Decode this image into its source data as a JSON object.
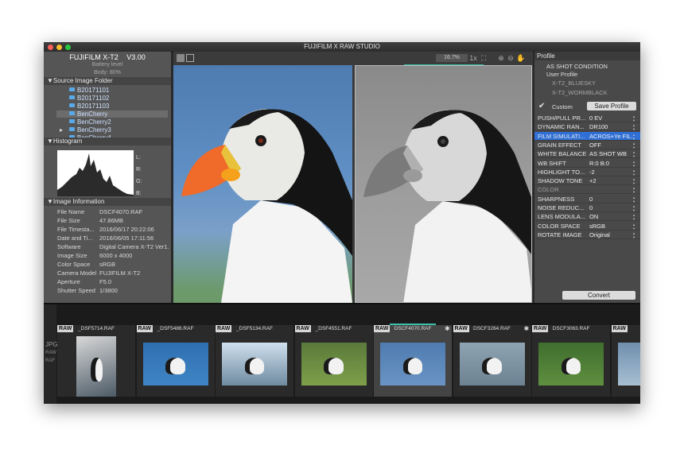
{
  "app": {
    "title": "FUJIFILM X RAW STUDIO"
  },
  "camera": {
    "model": "FUJIFILM X-T2",
    "version": "V3.00",
    "battery_label": "Battery level",
    "body_level": "Body: 80%"
  },
  "source_folder": {
    "header": "▼Source Image Folder",
    "folders": [
      "B20171101",
      "B20171102",
      "B20171103",
      "BenCherry",
      "BenCherry2",
      "BenCherry3",
      "BenCherry4"
    ],
    "selected_index": 3
  },
  "histogram": {
    "header": "▼Histogram",
    "labels": [
      "L:",
      "R:",
      "G:",
      "B:"
    ]
  },
  "image_info": {
    "header": "▼Image Information",
    "rows": [
      {
        "k": "File Name",
        "v": "DSCF4070.RAF"
      },
      {
        "k": "File Size",
        "v": "47.86MB"
      },
      {
        "k": "File Timesta...",
        "v": "2016/06/17 20:22:06"
      },
      {
        "k": "Date and Ti...",
        "v": "2016/06/05 17:11:56"
      },
      {
        "k": "Software",
        "v": "Digital Camera X-T2 Ver1."
      },
      {
        "k": "Image Size",
        "v": "6000 x 4000"
      },
      {
        "k": "Color Space",
        "v": "sRGB"
      },
      {
        "k": "Camera Model",
        "v": "FUJIFILM X-T2"
      },
      {
        "k": "Aperture",
        "v": "F5.0"
      },
      {
        "k": "Shutter Speed",
        "v": "1/3800"
      }
    ]
  },
  "viewer": {
    "zoom": "16.7%"
  },
  "profile": {
    "header": "Profile",
    "as_shot": "AS SHOT CONDITION",
    "user_profile": "User Profile",
    "presets": [
      "X-T2_BLUESKY",
      "X-T2_WORMBLACK"
    ],
    "custom_label": "Custom",
    "save_label": "Save Profile",
    "params": [
      {
        "k": "PUSH/PULL PR...",
        "v": "0 EV"
      },
      {
        "k": "DYNAMIC RAN...",
        "v": "DR100"
      },
      {
        "k": "FILM SIMULATI...",
        "v": "ACROS+Ye FIL..."
      },
      {
        "k": "GRAIN EFFECT",
        "v": "OFF"
      },
      {
        "k": "WHITE BALANCE",
        "v": "AS SHOT WB"
      },
      {
        "k": "WB SHIFT",
        "v": "R:0 B:0"
      },
      {
        "k": "HIGHLIGHT TO...",
        "v": "-2"
      },
      {
        "k": "SHADOW TONE",
        "v": "+2"
      },
      {
        "k": "COLOR",
        "v": ""
      },
      {
        "k": "SHARPNESS",
        "v": "0"
      },
      {
        "k": "NOISE REDUC...",
        "v": "0"
      },
      {
        "k": "LENS MODULA...",
        "v": "ON"
      },
      {
        "k": "COLOR SPACE",
        "v": "sRGB"
      },
      {
        "k": "ROTATE IMAGE",
        "v": "Original"
      }
    ],
    "convert_label": "Convert"
  },
  "filmstrip": {
    "raw_badge": "RAW",
    "rail_labels": [
      "JPG",
      "RAW",
      "RAF"
    ],
    "items": [
      {
        "name": "_DSF5714.RAF",
        "selected": false,
        "star": false
      },
      {
        "name": "_DSF5486.RAF",
        "selected": false,
        "star": false
      },
      {
        "name": "_DSF5134.RAF",
        "selected": false,
        "star": false
      },
      {
        "name": "_DSF4551.RAF",
        "selected": false,
        "star": false
      },
      {
        "name": "DSCF4070.RAF",
        "selected": true,
        "star": true
      },
      {
        "name": "DSCF3264.RAF",
        "selected": false,
        "star": true
      },
      {
        "name": "DSCF3063.RAF",
        "selected": false,
        "star": false
      },
      {
        "name": "",
        "selected": false,
        "star": false
      }
    ]
  },
  "colors": {
    "accent": "#2f6fd6",
    "progress": "#39c0a8"
  }
}
